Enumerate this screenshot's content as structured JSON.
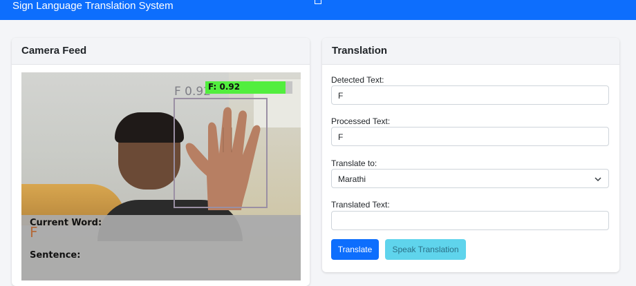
{
  "navbar": {
    "title": "Sign Language Translation System"
  },
  "camera": {
    "header": "Camera Feed",
    "overlay": {
      "bbox_text": "F 0.92",
      "confidence_text": "F: 0.92",
      "confidence_value": 0.92,
      "current_word_label": "Current Word:",
      "current_word_value": "F",
      "sentence_label": "Sentence:"
    }
  },
  "translation": {
    "header": "Translation",
    "detected_label": "Detected Text:",
    "detected_value": "F",
    "processed_label": "Processed Text:",
    "processed_value": "F",
    "translate_to_label": "Translate to:",
    "translate_to_value": "Marathi",
    "translated_label": "Translated Text:",
    "translated_value": "",
    "translate_button": "Translate",
    "speak_button": "Speak Translation"
  },
  "colors": {
    "primary": "#0d6efd",
    "info": "#5fd4ec",
    "confidence_bar": "#52ee3e"
  },
  "icons": {
    "select_chevron": "chevron-down-icon"
  }
}
